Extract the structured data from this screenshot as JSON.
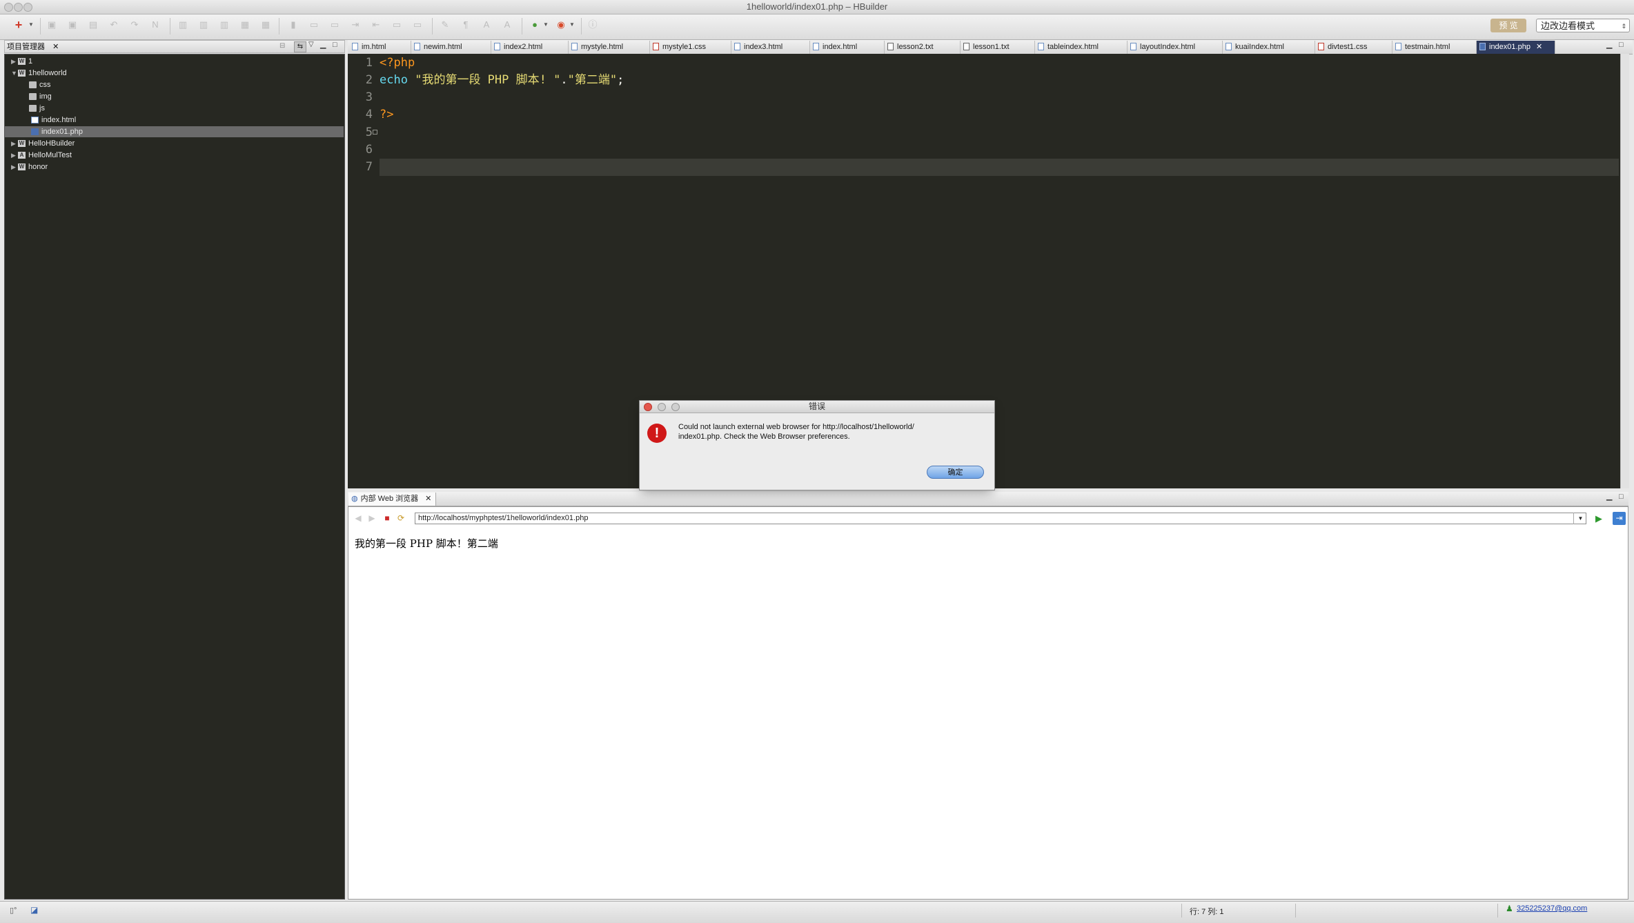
{
  "window": {
    "title": "1helloworld/index01.php – HBuilder"
  },
  "toolbar": {
    "preview_label": "预 览",
    "mode_value": "边改边看模式"
  },
  "project_panel": {
    "title": "项目管理器",
    "items": [
      {
        "label": "1",
        "type": "project"
      },
      {
        "label": "1helloworld",
        "type": "project"
      },
      {
        "label": "css",
        "type": "folder"
      },
      {
        "label": "img",
        "type": "folder"
      },
      {
        "label": "js",
        "type": "folder"
      },
      {
        "label": "index.html",
        "type": "file"
      },
      {
        "label": "index01.php",
        "type": "file",
        "selected": true
      },
      {
        "label": "HelloHBuilder",
        "type": "project"
      },
      {
        "label": "HelloMulTest",
        "type": "project"
      },
      {
        "label": "honor",
        "type": "project"
      }
    ]
  },
  "editor_tabs": [
    "im.html",
    "newim.html",
    "index2.html",
    "mystyle.html",
    "mystyle1.css",
    "index3.html",
    "index.html",
    "lesson2.txt",
    "lesson1.txt",
    "tableindex.html",
    "layoutIndex.html",
    "kuaiIndex.html",
    "divtest1.css",
    "testmain.html",
    "index01.php"
  ],
  "active_tab": "index01.php",
  "editor": {
    "line_numbers": [
      "1",
      "2",
      "3",
      "4",
      "5",
      "6",
      "7"
    ],
    "line1": "<?php",
    "line2_kw": "echo",
    "line2_str1": "\"我的第一段 PHP 脚本! \"",
    "line2_dot": ".",
    "line2_str2": "\"第二端\"",
    "line2_end": ";",
    "line4": "?>"
  },
  "browser": {
    "tab_label": "内部 Web 浏览器",
    "url": "http://localhost/myphptest/1helloworld/index01.php",
    "content": "我的第一段 PHP 脚本！第二端"
  },
  "dialog": {
    "title": "错误",
    "message_line1": "Could not launch external web browser for http://localhost/1helloworld/",
    "message_line2": "index01.php. Check the Web Browser preferences.",
    "ok_label": "确定"
  },
  "statusbar": {
    "position": "行: 7 列: 1",
    "user": "325225237@qq.com"
  },
  "colors": {
    "editor_bg": "#272822",
    "php_tag": "#fd971f",
    "keyword": "#66d9ef",
    "string": "#e6db74",
    "error_icon": "#d01818"
  }
}
